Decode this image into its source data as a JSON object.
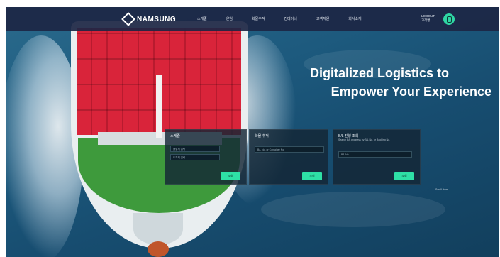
{
  "nav": {
    "logo_text": "NAMSUNG",
    "menu": [
      "스케줄",
      "운임",
      "화물추적",
      "컨테이너",
      "고객지원",
      "회사소개"
    ],
    "user_line1": "LOGOUT",
    "user_line2": "고객명"
  },
  "hero": {
    "line1": "Digitalized Logistics to",
    "line2": "Empower Your Experience"
  },
  "cards": [
    {
      "title": "스케줄",
      "inputs": [
        "출발지 입력",
        "도착지 입력"
      ],
      "button": "조회"
    },
    {
      "title": "화물 추적",
      "inputs": [
        "B/L No. or Container No."
      ],
      "button": "조회"
    },
    {
      "title": "B/L 진행 조회",
      "subtitle": "Search B/L progress by B/L No. or Booking No.",
      "inputs": [
        "B/L No."
      ],
      "button": "조회"
    }
  ],
  "footer_note": "Scroll down",
  "colors": {
    "nav_bg": "#1c2644",
    "accent": "#2ee0a6",
    "container_red": "#d9243a",
    "deck_green": "#3e9a3c"
  }
}
